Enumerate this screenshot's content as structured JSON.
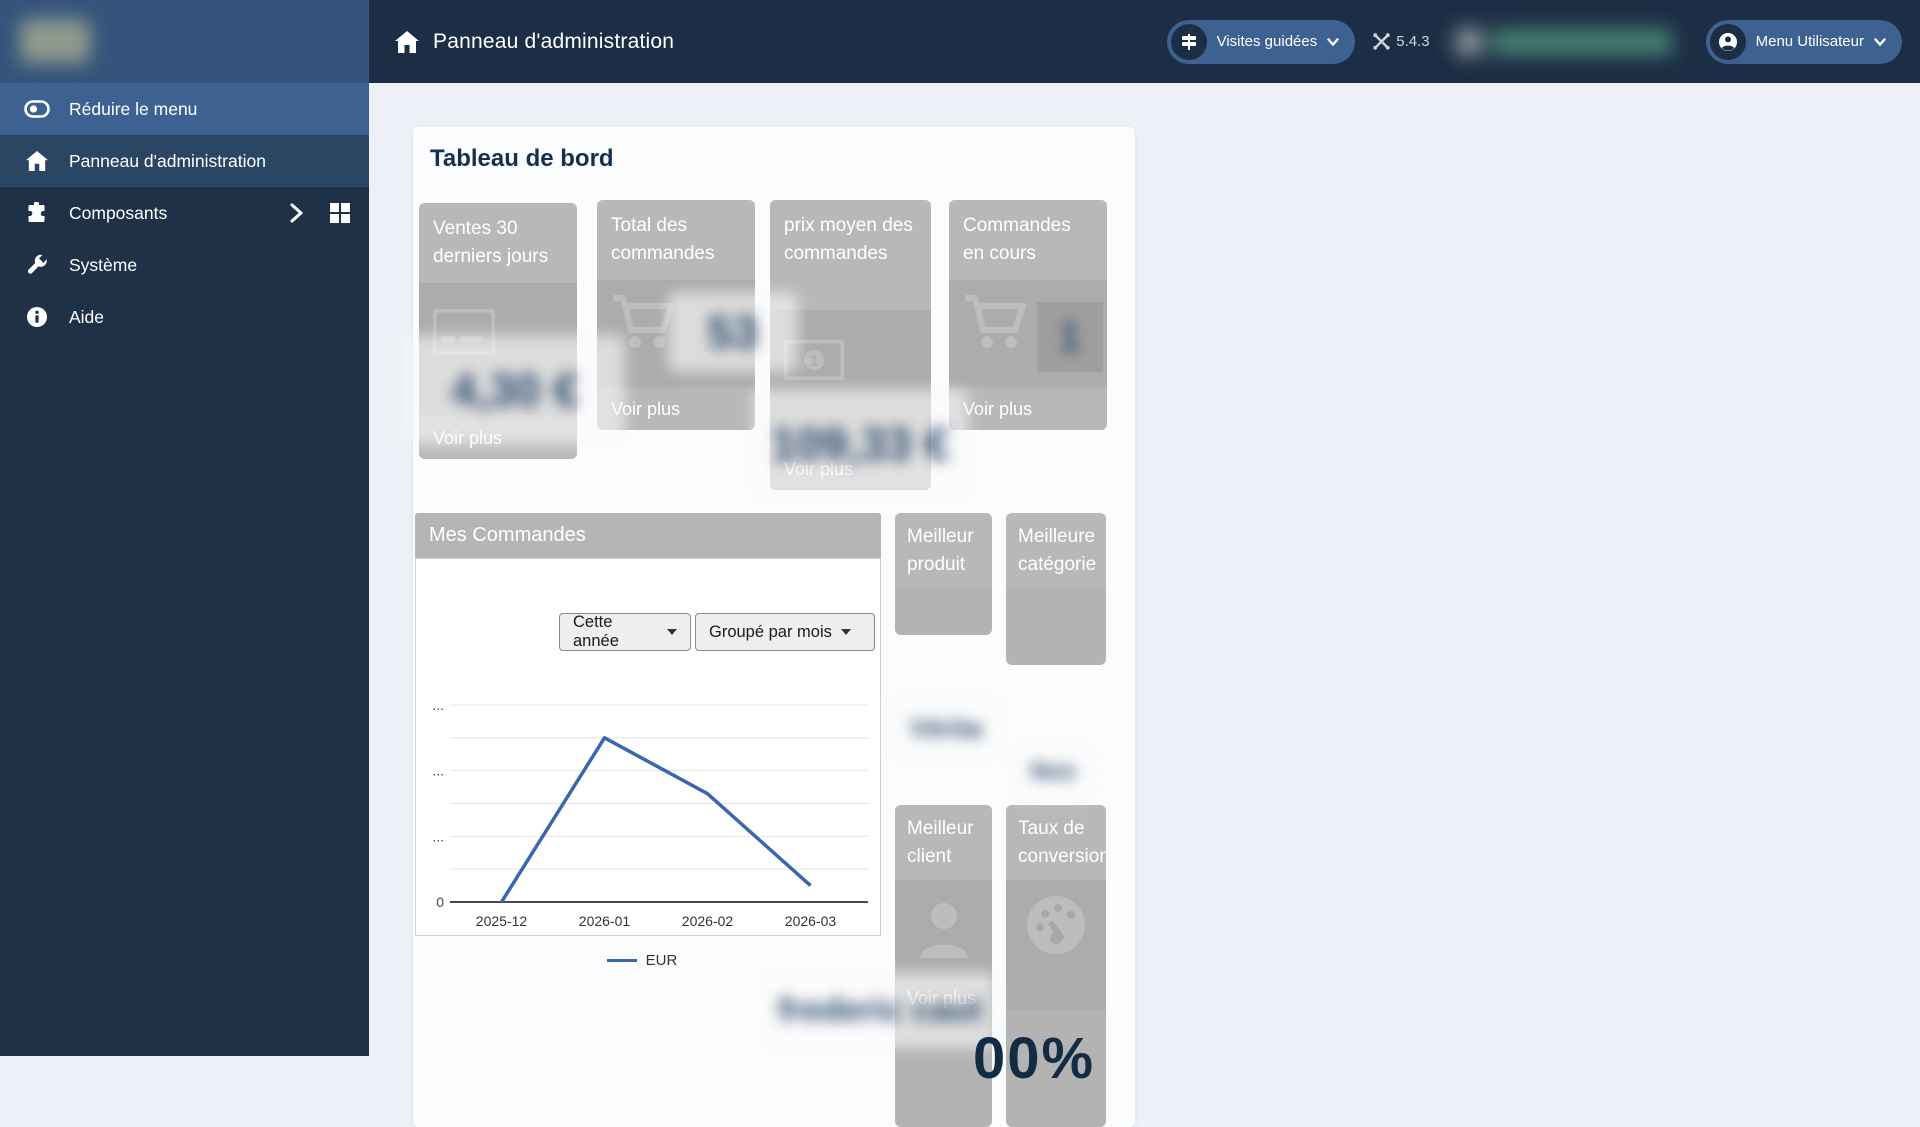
{
  "header": {
    "title": "Panneau d'administration",
    "guided_tours_label": "Visites guidées",
    "version": "5.4.3",
    "user_menu_label": "Menu Utilisateur"
  },
  "sidebar": {
    "items": [
      {
        "label": "Réduire le menu",
        "icon": "toggle-icon"
      },
      {
        "label": "Panneau d'administration",
        "icon": "home-icon"
      },
      {
        "label": "Composants",
        "icon": "puzzle-icon"
      },
      {
        "label": "Système",
        "icon": "wrench-icon"
      },
      {
        "label": "Aide",
        "icon": "info-icon"
      }
    ]
  },
  "main": {
    "page_title": "Tableau de bord",
    "kpi_cards": [
      {
        "title": "Ventes 30 derniers jours",
        "value": "4,30 €",
        "link_label": "Voir plus",
        "icon": "credit-card-icon"
      },
      {
        "title": "Total des commandes",
        "value": "53",
        "link_label": "Voir plus",
        "icon": "cart-icon"
      },
      {
        "title": "prix moyen des commandes",
        "value": "109,33 €",
        "link_label": "Voir plus",
        "icon": "money-bill-icon"
      },
      {
        "title": "Commandes en cours",
        "value": "1",
        "link_label": "Voir plus",
        "icon": "cart-icon"
      }
    ],
    "orders_panel": {
      "title": "Mes Commandes",
      "filters": [
        {
          "label": "Cette année"
        },
        {
          "label": "Groupé par mois"
        }
      ]
    },
    "side_cards": {
      "best_product": {
        "title": "Meilleur produit",
        "value": "Vérita",
        "icon": null
      },
      "best_category": {
        "title": "Meilleure catégorie",
        "value": "Nos",
        "icon": null
      },
      "best_customer": {
        "title": "Meilleur client",
        "value": "frederic caut",
        "link_label": "Voir plus",
        "icon": "person-icon"
      },
      "conversion_rate": {
        "title": "Taux de conversion",
        "value": "00%",
        "icon": "gauge-icon"
      }
    }
  },
  "chart_data": {
    "type": "line",
    "title": "Mes Commandes",
    "x": [
      "2025-12",
      "2026-01",
      "2026-02",
      "2026-03"
    ],
    "series": [
      {
        "name": "EUR",
        "values": [
          0,
          5.0,
          3.3,
          0.5
        ]
      }
    ],
    "ylim": [
      0,
      6
    ],
    "yticks": [
      {
        "v": 6,
        "label": "..."
      },
      {
        "v": 4,
        "label": "..."
      },
      {
        "v": 2,
        "label": "..."
      },
      {
        "v": 0,
        "label": "0"
      }
    ],
    "grid": true,
    "legend_position": "bottom",
    "line_color": "#3a66ad"
  },
  "colors": {
    "header_bg": "#1c2e45",
    "header_logo_block": "#35547b",
    "sidebar_bg": "#1f3147",
    "highlight_blue": "#3d6190",
    "active_row": "#2b4663",
    "content_bg": "#edf1f7",
    "card_grey": "#b3b3b3",
    "line_blue": "#3a66ad",
    "title_navy": "#15304e"
  }
}
